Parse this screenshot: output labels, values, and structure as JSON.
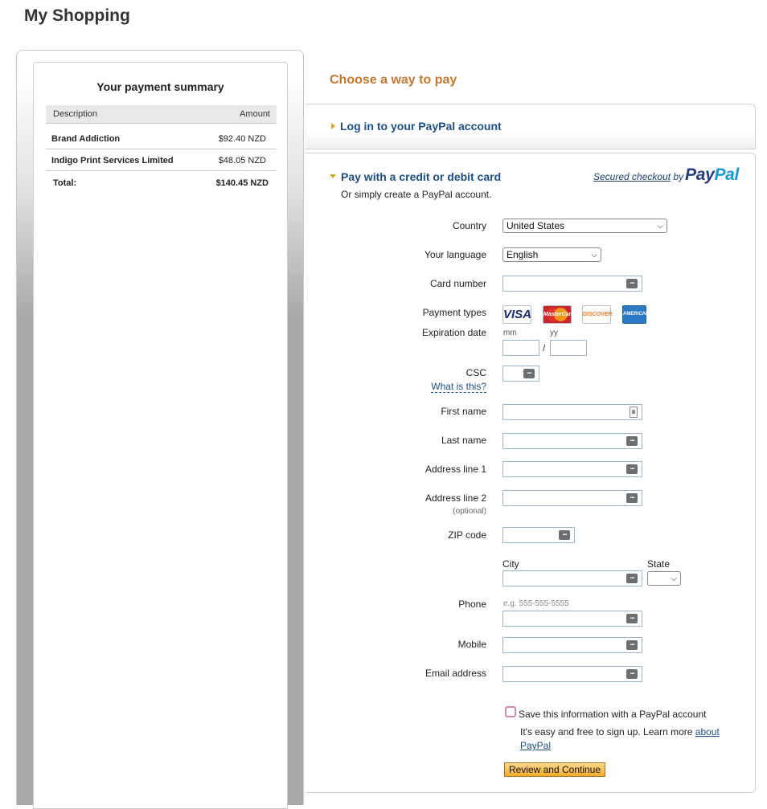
{
  "page": {
    "title": "My Shopping"
  },
  "summary": {
    "title": "Your payment summary",
    "header": {
      "description": "Description",
      "amount": "Amount"
    },
    "items": [
      {
        "description": "Brand Addiction",
        "amount": "$92.40 NZD"
      },
      {
        "description": "Indigo Print Services Limited",
        "amount": "$48.05 NZD"
      }
    ],
    "total": {
      "label": "Total:",
      "amount": "$140.45 NZD"
    }
  },
  "pay": {
    "choose_title": "Choose a way to pay",
    "login_heading": "Log in to your PayPal account",
    "card_heading": "Pay with a credit or debit card",
    "card_subtext": "Or simply create a PayPal account.",
    "secured_link": "Secured checkout",
    "secured_by": "by",
    "logo_pay": "Pay",
    "logo_pal": "Pal"
  },
  "form": {
    "country": {
      "label": "Country",
      "value": "United States"
    },
    "language": {
      "label": "Your language",
      "value": "English"
    },
    "card_number": {
      "label": "Card number",
      "value": ""
    },
    "payment_types": {
      "label": "Payment types",
      "cards": [
        "VISA",
        "MasterCard",
        "DISCOVER",
        "AMERICAN EXPRESS"
      ]
    },
    "expiration": {
      "label": "Expiration date",
      "mm_hint": "mm",
      "yy_hint": "yy",
      "separator": "/"
    },
    "csc": {
      "label": "CSC",
      "help_link": "What is this?"
    },
    "first_name": {
      "label": "First name"
    },
    "last_name": {
      "label": "Last name"
    },
    "address1": {
      "label": "Address line 1"
    },
    "address2": {
      "label": "Address line 2",
      "note": "(optional)"
    },
    "zip": {
      "label": "ZIP code"
    },
    "city": {
      "label": "City"
    },
    "state": {
      "label": "State",
      "value": ""
    },
    "phone": {
      "label": "Phone",
      "hint": "e.g. 555-555-5555"
    },
    "mobile": {
      "label": "Mobile"
    },
    "email": {
      "label": "Email address"
    },
    "save": {
      "label": "Save this information with a PayPal account",
      "text": "It's easy and free to sign up. Learn more",
      "link": "about PayPal"
    },
    "submit": "Review and Continue"
  },
  "colors": {
    "accent_orange": "#c8772f",
    "link_blue": "#1b4f87",
    "button_orange": "#f5ac2e"
  }
}
